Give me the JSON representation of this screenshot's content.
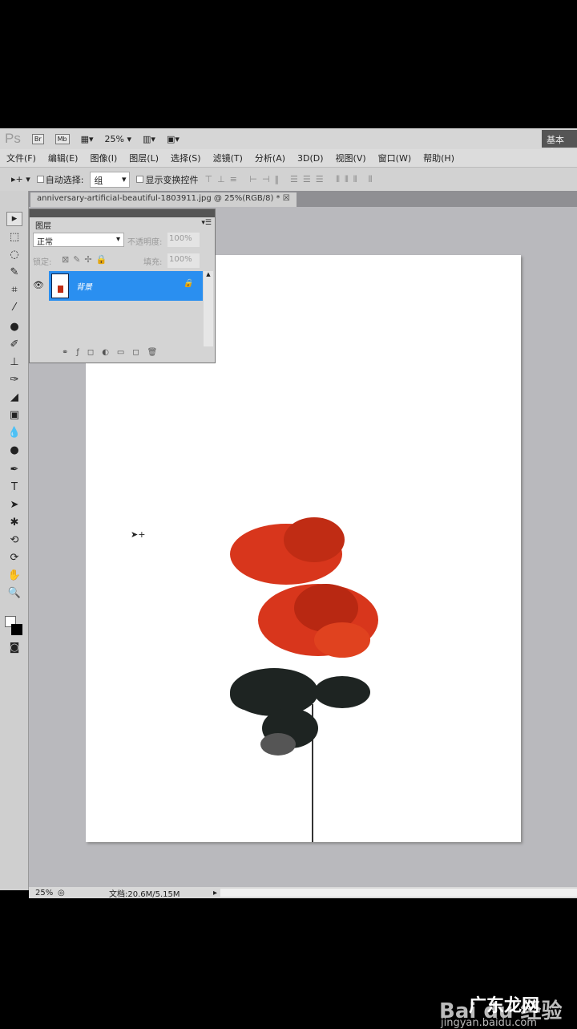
{
  "appbar": {
    "logo": "Ps",
    "br": "Br",
    "mb": "Mb",
    "zoom": "25%",
    "workspace": "基本功"
  },
  "menu": [
    "文件(F)",
    "编辑(E)",
    "图像(I)",
    "图层(L)",
    "选择(S)",
    "滤镜(T)",
    "分析(A)",
    "3D(D)",
    "视图(V)",
    "窗口(W)",
    "帮助(H)"
  ],
  "options": {
    "auto_select_label": "自动选择:",
    "auto_select_value": "组",
    "show_transform_label": "显示变换控件"
  },
  "document": {
    "tab_title": "anniversary-artificial-beautiful-1803911.jpg @ 25%(RGB/8) *"
  },
  "layers_panel": {
    "title": "图层",
    "blend_mode": "正常",
    "opacity_label": "不透明度:",
    "opacity": "100%",
    "lock_label": "锁定:",
    "fill_label": "填充:",
    "fill": "100%",
    "layers": [
      {
        "name": "背景",
        "visible": true,
        "locked": true
      }
    ]
  },
  "status": {
    "zoom": "25%",
    "doc_info": "文档:20.6M/5.15M"
  },
  "watermark": {
    "brand": "Bai du 经验",
    "url": "jingyan.baidu.com",
    "overlay": "广东龙网"
  },
  "colors": {
    "selection": "#2a8ff0",
    "rose": "#d8361c",
    "canvas_bg": "#b9b9bd"
  }
}
